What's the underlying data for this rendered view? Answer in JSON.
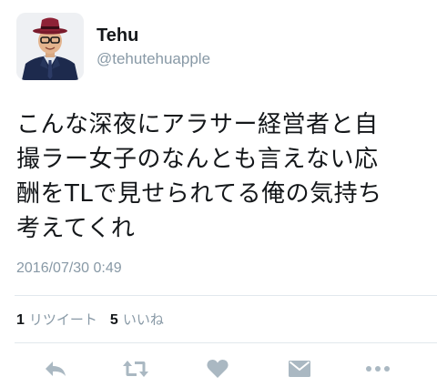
{
  "user": {
    "display_name": "Tehu",
    "handle": "@tehutehuapple",
    "avatar": "profile-photo"
  },
  "tweet": {
    "lines": [
      "こんな深夜にアラサー経営者と自",
      "撮ラー女子のなんとも言えない応",
      "酬をTLで見せられてる俺の気持ち",
      "考えてくれ"
    ],
    "timestamp": "2016/07/30 0:49"
  },
  "stats": {
    "retweets_count": "1",
    "retweets_label": "リツイート",
    "likes_count": "5",
    "likes_label": "いいね"
  },
  "actions": [
    {
      "name": "reply",
      "icon": "reply-icon"
    },
    {
      "name": "retweet",
      "icon": "retweet-icon"
    },
    {
      "name": "like",
      "icon": "heart-icon"
    },
    {
      "name": "direct-message",
      "icon": "envelope-icon"
    },
    {
      "name": "more",
      "icon": "more-dots-icon"
    }
  ],
  "colors": {
    "text": "#14171a",
    "secondary": "#8899a6",
    "icon": "#aab8c2",
    "divider": "#e1e8ed"
  }
}
